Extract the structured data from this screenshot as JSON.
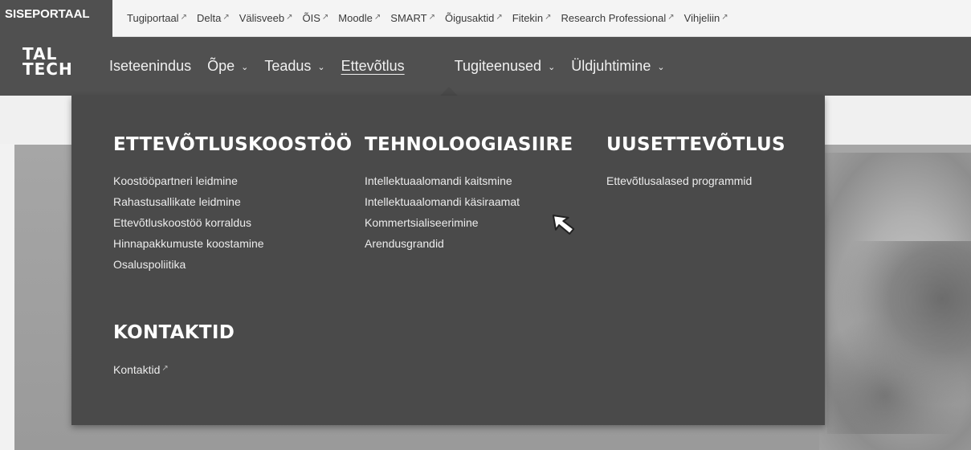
{
  "topbar": {
    "brand": "SISEPORTAAL",
    "links": [
      {
        "label": "Tugiportaal"
      },
      {
        "label": "Delta"
      },
      {
        "label": "Välisveeb"
      },
      {
        "label": "ÕIS"
      },
      {
        "label": "Moodle"
      },
      {
        "label": "SMART"
      },
      {
        "label": "Õigusaktid"
      },
      {
        "label": "Fitekin"
      },
      {
        "label": "Research Professional"
      },
      {
        "label": "Vihjeliin"
      }
    ],
    "external_icon": "↗"
  },
  "logo": {
    "line1": "TAL",
    "line2": "TECH"
  },
  "nav": {
    "items": [
      {
        "label": "Iseteenindus"
      },
      {
        "label": "Õpe"
      },
      {
        "label": "Teadus"
      },
      {
        "label": "Ettevõtlus"
      },
      {
        "label": "Tugiteenused"
      },
      {
        "label": "Üldjuhtimine"
      }
    ],
    "chevron": "⌄"
  },
  "dropdown": {
    "columns": [
      {
        "heading": "ETTEVÕTLUSKOOSTÖÖ",
        "items": [
          "Koostööpartneri leidmine",
          "Rahastusallikate leidmine",
          "Ettevõtluskoostöö korraldus",
          "Hinnapakkumuste koostamine",
          "Osaluspoliitika"
        ]
      },
      {
        "heading": "TEHNOLOOGIASIIRE",
        "items": [
          "Intellektuaalomandi kaitsmine",
          "Intellektuaalomandi käsiraamat",
          "Kommertsialiseerimine",
          "Arendusgrandid"
        ]
      },
      {
        "heading": "UUSETTEVÕTLUS",
        "items": [
          "Ettevõtlusalased programmid"
        ]
      },
      {
        "heading": "KONTAKTID",
        "items": [
          "Kontaktid"
        ]
      }
    ]
  },
  "colors": {
    "nav_bg": "#505050",
    "dropdown_bg": "#4a4a4a",
    "topbar_bg": "#f4f4f4"
  }
}
